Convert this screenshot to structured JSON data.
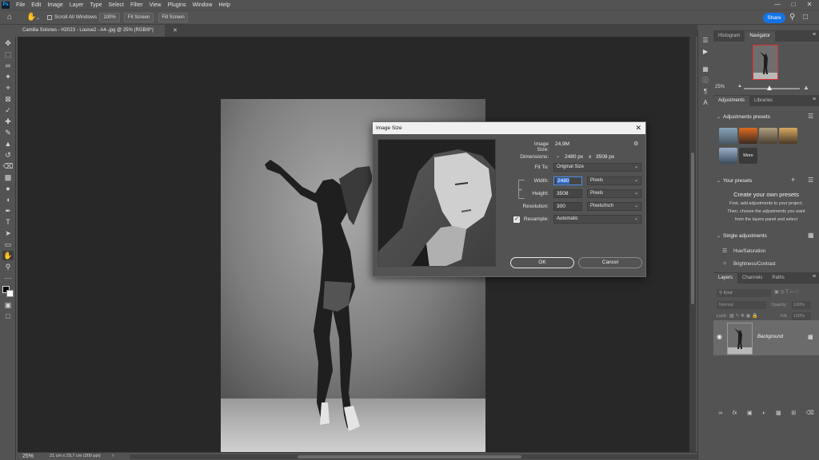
{
  "menubar": {
    "logo": "Ps",
    "items": [
      "File",
      "Edit",
      "Image",
      "Layer",
      "Type",
      "Select",
      "Filter",
      "View",
      "Plugins",
      "Window",
      "Help"
    ]
  },
  "options": {
    "scroll_all_windows": "Scroll All Windows",
    "zoom_100": "100%",
    "fit_screen": "Fit Screen",
    "fill_screen": "Fill Screen",
    "share": "Share"
  },
  "document": {
    "tab_title": "Camilla Solsnes - H2023 - Louise2 - A4-.jpg @ 25% (RGB/8*)"
  },
  "status": {
    "zoom": "25%",
    "info": "21 cm x 29,7 cm (300 ppi)"
  },
  "navigator": {
    "tab_histogram": "Histogram",
    "tab_navigator": "Navigator",
    "zoom": "25%"
  },
  "adjustments": {
    "tab_adjustments": "Adjustments",
    "tab_libraries": "Libraries",
    "presets_heading": "Adjustments presets",
    "more_label": "More",
    "your_presets_heading": "Your presets",
    "create_title": "Create your own presets",
    "create_body_1": "First, add adjustments to your project.",
    "create_body_2": "Then, choose the adjustments you want",
    "create_body_3": "from the layers panel and select",
    "single_heading": "Single adjustments",
    "item_hue": "Hue/Saturation",
    "item_brightness": "Brightness/Contrast"
  },
  "layers": {
    "tab_layers": "Layers",
    "tab_channels": "Channels",
    "tab_paths": "Paths",
    "kind_placeholder": "Kind",
    "blend_mode": "Normal",
    "opacity_label": "Opacity:",
    "opacity_value": "100%",
    "lock_label": "Lock:",
    "fill_label": "Fill:",
    "fill_value": "100%",
    "layer_name": "Background"
  },
  "dialog": {
    "title": "Image Size",
    "image_size_label": "Image Size:",
    "image_size_value": "24,9M",
    "dimensions_label": "Dimensions:",
    "dimensions_width": "2480 px",
    "dimensions_x": "x",
    "dimensions_height": "3508 px",
    "fit_to_label": "Fit To:",
    "fit_to_value": "Original Size",
    "width_label": "Width:",
    "width_value": "2480",
    "width_unit": "Pixels",
    "height_label": "Height:",
    "height_value": "3508",
    "height_unit": "Pixels",
    "resolution_label": "Resolution:",
    "resolution_value": "300",
    "resolution_unit": "Pixels/Inch",
    "resample_label": "Resample:",
    "resample_value": "Automatic",
    "ok": "OK",
    "cancel": "Cancel"
  },
  "colors": {
    "app_bg": "#535353",
    "canvas_bg": "#282828",
    "accent_blue": "#1473e6",
    "navigator_frame": "#e03030"
  }
}
